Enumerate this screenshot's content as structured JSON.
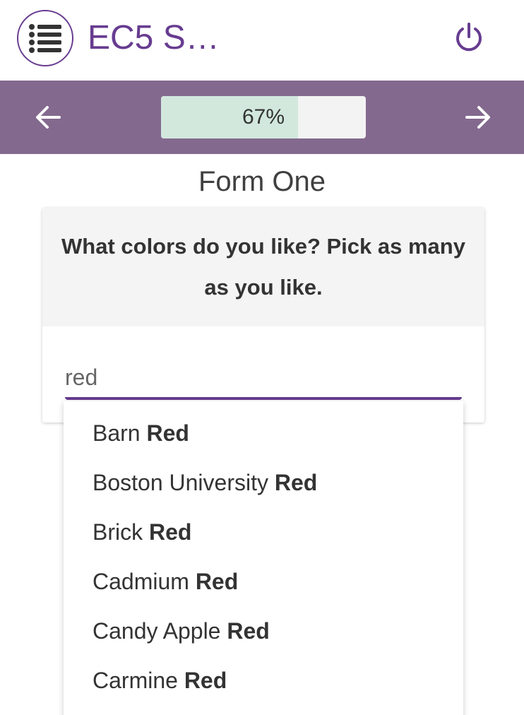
{
  "app": {
    "title": "EC5 S…",
    "brand_color": "#673c90",
    "nav_color": "#83698e",
    "menu_icon": "list-icon",
    "power_icon": "power-icon"
  },
  "nav": {
    "prev_icon": "arrow-left-icon",
    "next_icon": "arrow-right-icon",
    "progress_fraction": 0.67,
    "progress_text": "67%",
    "progress_fill_color": "#d2e8dd"
  },
  "form": {
    "title": "Form One",
    "question": "What colors do you like? Pick as many as you like.",
    "search": {
      "value": "red",
      "placeholder": ""
    },
    "options": [
      {
        "prefix": "Barn ",
        "match": "Red"
      },
      {
        "prefix": "Boston University ",
        "match": "Red"
      },
      {
        "prefix": "Brick ",
        "match": "Red"
      },
      {
        "prefix": "Cadmium ",
        "match": "Red"
      },
      {
        "prefix": "Candy Apple ",
        "match": "Red"
      },
      {
        "prefix": "Carmine ",
        "match": "Red"
      }
    ]
  }
}
